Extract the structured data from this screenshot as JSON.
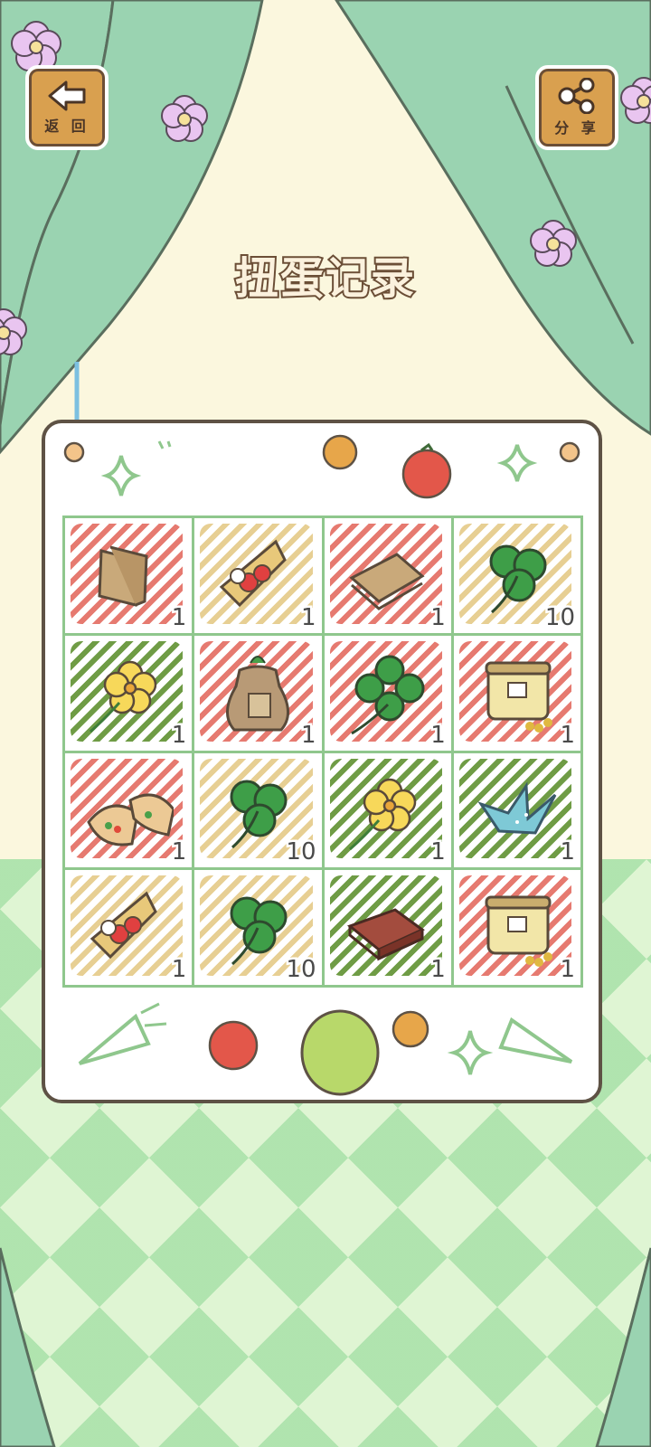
{
  "header": {
    "back_label": "返 回",
    "share_label": "分 享",
    "title": "扭蛋记录"
  },
  "records": [
    {
      "item": "sandwich",
      "count": "1",
      "hatch": "red"
    },
    {
      "item": "crepe",
      "count": "1",
      "hatch": "tan"
    },
    {
      "item": "toast-sandwich",
      "count": "1",
      "hatch": "red"
    },
    {
      "item": "three-leaf-clover",
      "count": "10",
      "hatch": "tan"
    },
    {
      "item": "yellow-flower",
      "count": "1",
      "hatch": "green"
    },
    {
      "item": "seed-bag",
      "count": "1",
      "hatch": "red"
    },
    {
      "item": "four-leaf-clover",
      "count": "1",
      "hatch": "red"
    },
    {
      "item": "jar",
      "count": "1",
      "hatch": "red"
    },
    {
      "item": "pita-bread",
      "count": "1",
      "hatch": "red"
    },
    {
      "item": "three-leaf-clover",
      "count": "10",
      "hatch": "tan"
    },
    {
      "item": "yellow-flower",
      "count": "1",
      "hatch": "green"
    },
    {
      "item": "paper-crane",
      "count": "1",
      "hatch": "green"
    },
    {
      "item": "crepe",
      "count": "1",
      "hatch": "tan"
    },
    {
      "item": "three-leaf-clover",
      "count": "10",
      "hatch": "tan"
    },
    {
      "item": "chocolate",
      "count": "1",
      "hatch": "green"
    },
    {
      "item": "jar",
      "count": "1",
      "hatch": "red"
    }
  ]
}
